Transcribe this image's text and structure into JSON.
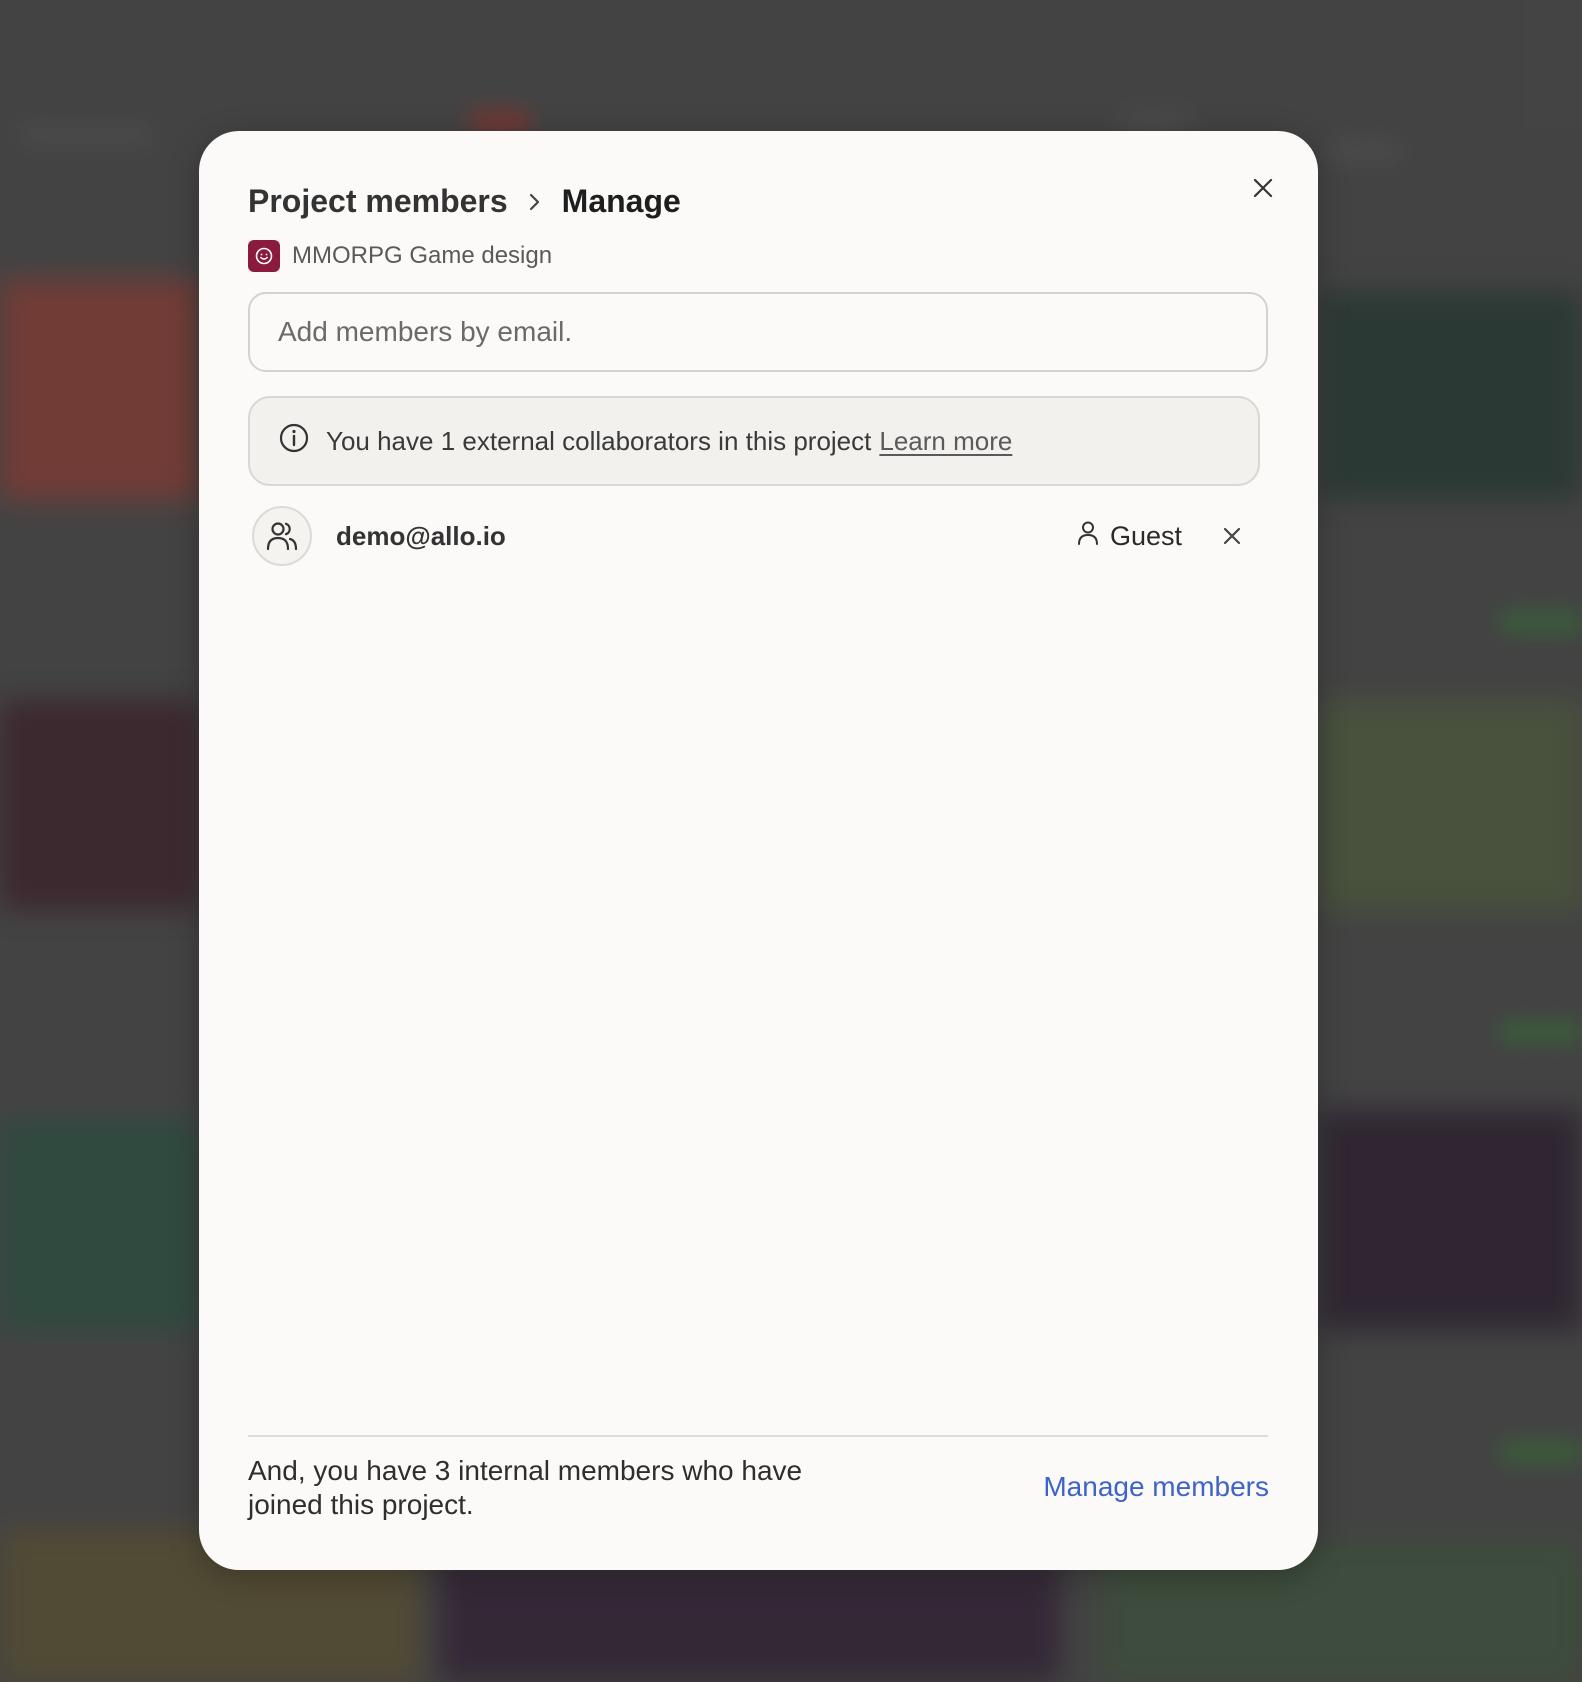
{
  "colors": {
    "accent": "#3e63c9",
    "project_icon_bg": "#8a1a3e"
  },
  "modal": {
    "breadcrumb": {
      "parent": "Project members",
      "current": "Manage"
    },
    "close_icon": "close-icon",
    "project": {
      "icon": "smiley-icon",
      "name": "MMORPG Game design"
    },
    "email_input": {
      "placeholder": "Add members by email.",
      "value": ""
    },
    "info": {
      "icon": "info-icon",
      "text": "You have 1 external collaborators in this project",
      "link": "Learn more"
    },
    "members": [
      {
        "avatar_icon": "users-icon",
        "email": "demo@allo.io",
        "role_icon": "person-icon",
        "role": "Guest"
      }
    ],
    "footer": {
      "text": "And, you have 3 internal members who have joined this project.",
      "link": "Manage members"
    }
  }
}
